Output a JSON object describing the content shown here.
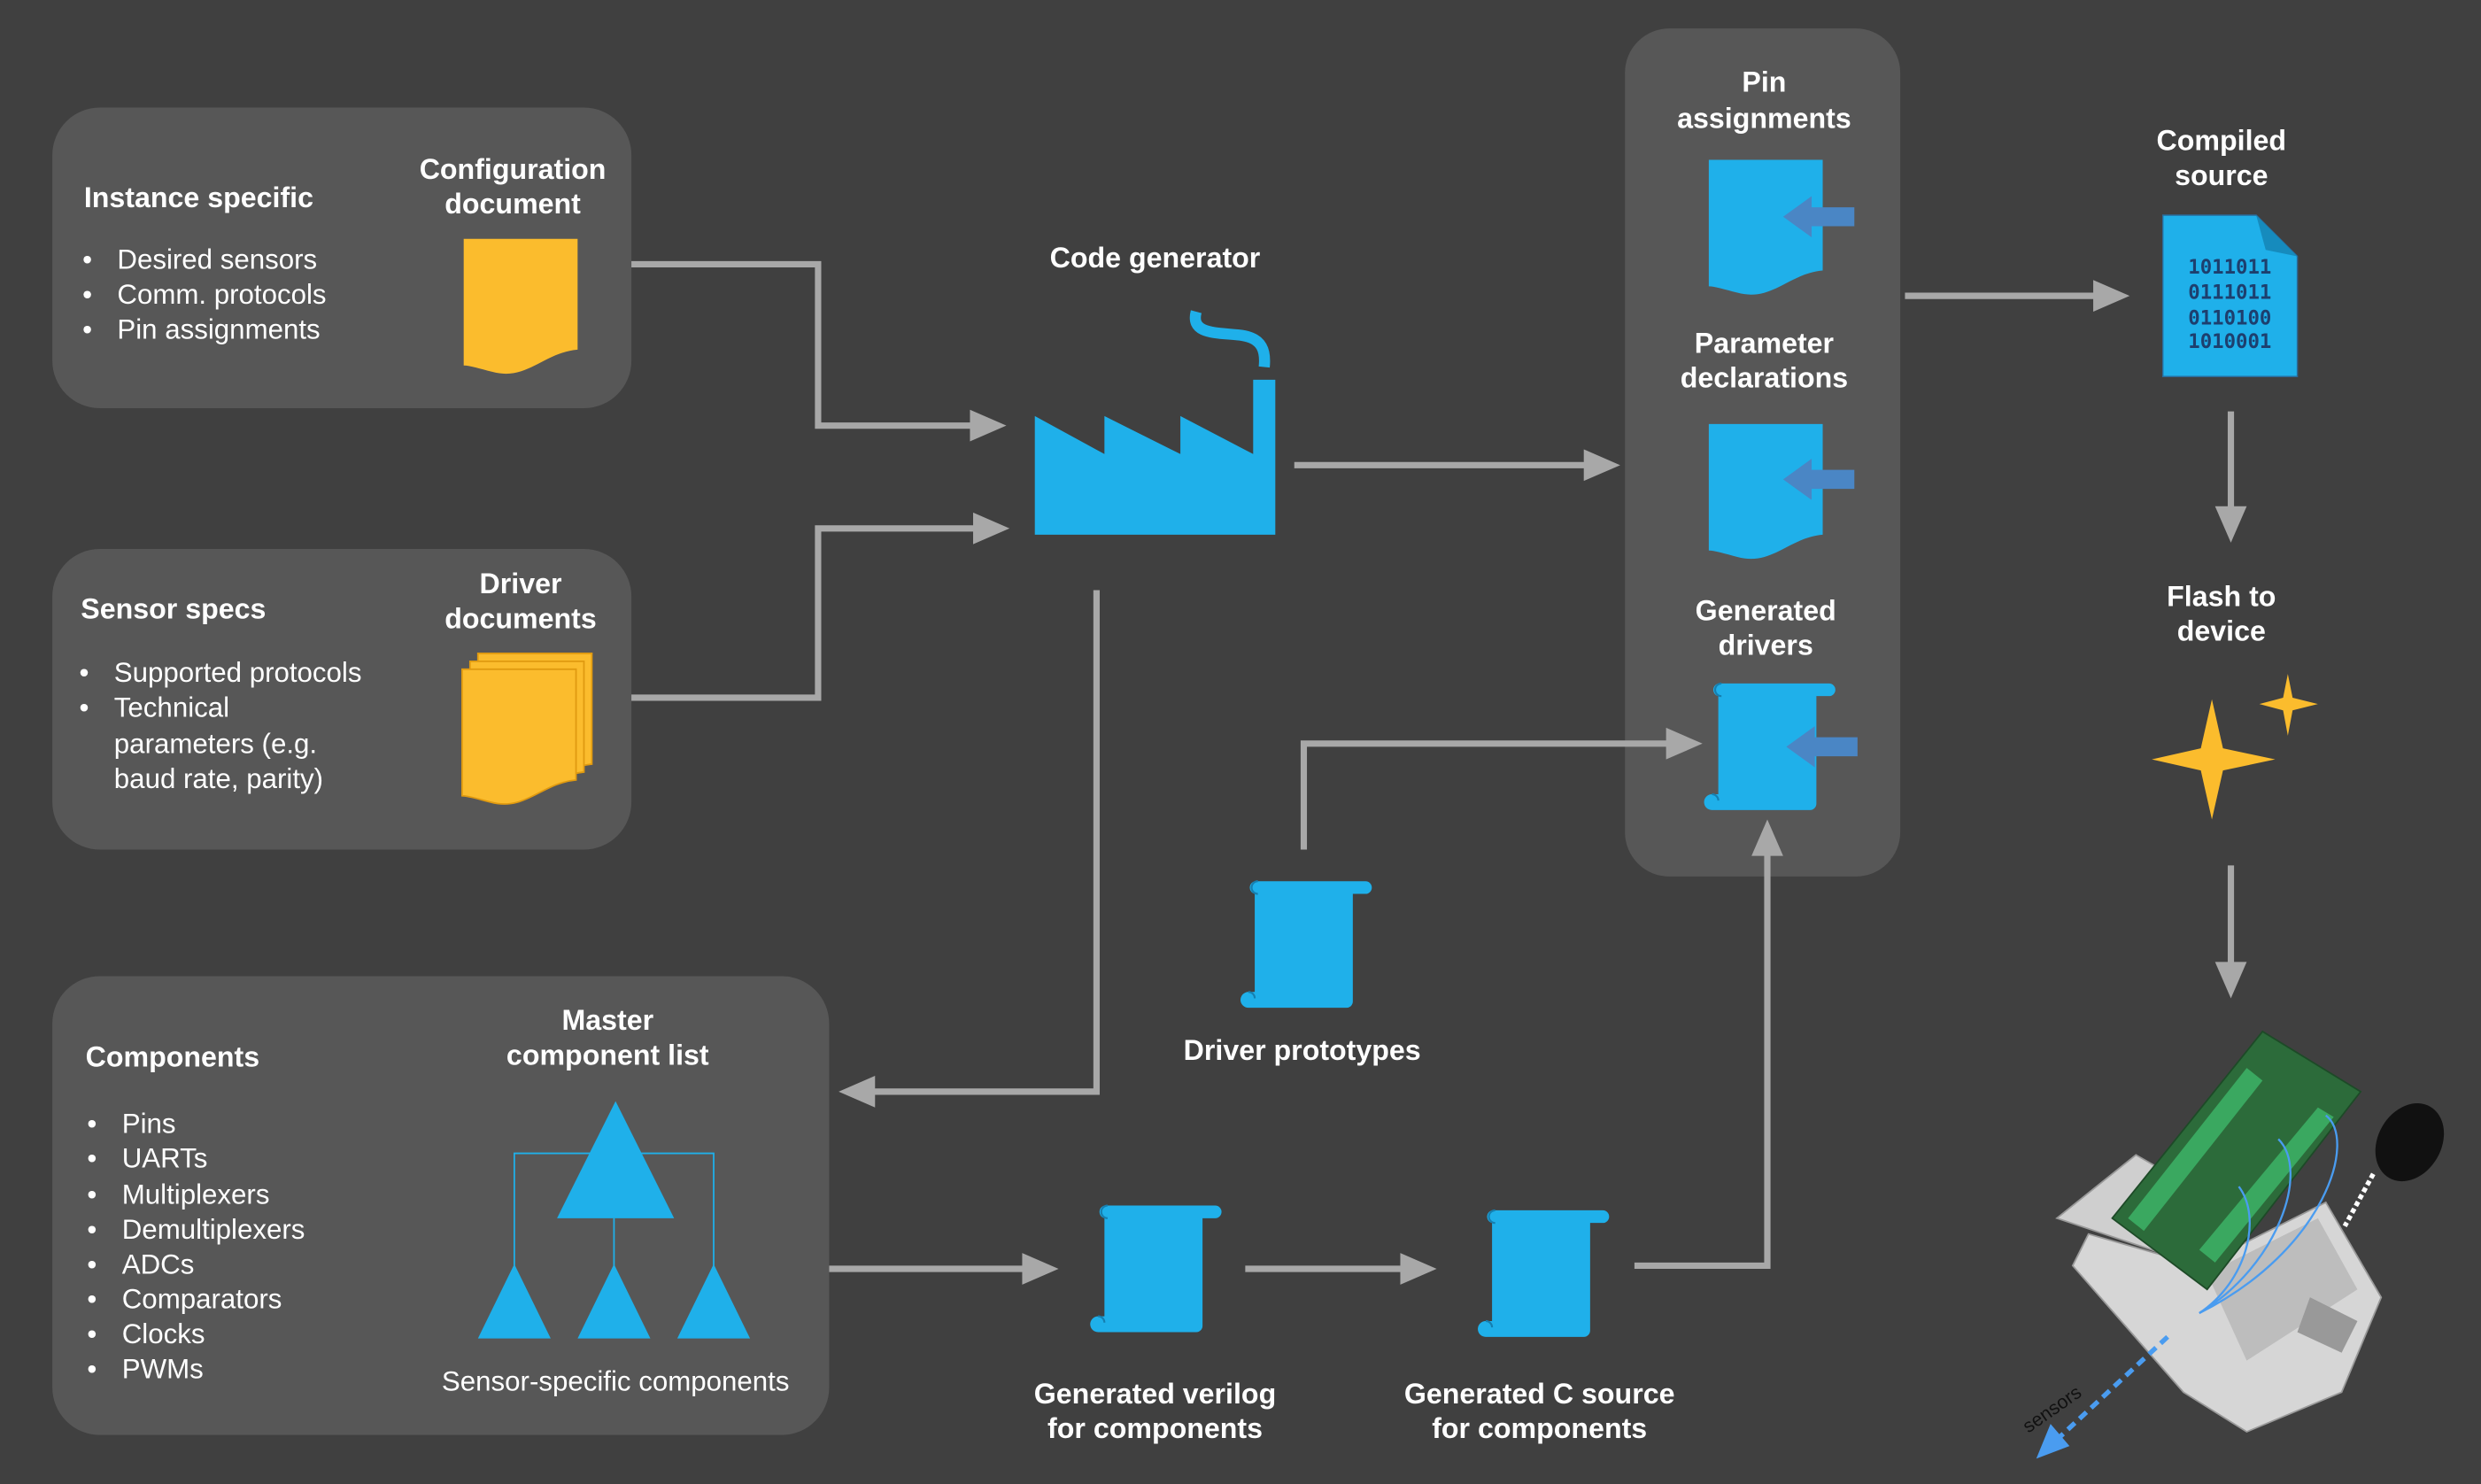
{
  "colors": {
    "background": "#404040",
    "panel": "#575757",
    "document_blue": "#1fb0ea",
    "document_yellow": "#fbbc2d",
    "arrow": "#a8a8a8",
    "star": "#fbbc2d"
  },
  "instance": {
    "title": "Instance specific",
    "bullets": [
      "Desired sensors",
      "Comm. protocols",
      "Pin assignments"
    ],
    "doc_label": [
      "Configuration",
      "document"
    ]
  },
  "sensor": {
    "title": "Sensor specs",
    "bullets": [
      "Supported protocols",
      "Technical",
      "parameters (e.g.",
      "baud rate, parity)"
    ],
    "doc_label": [
      "Driver",
      "documents"
    ]
  },
  "generator": {
    "label": "Code generator"
  },
  "outputs": {
    "pins": [
      "Pin",
      "assignments"
    ],
    "params": [
      "Parameter",
      "declarations"
    ],
    "drivers": [
      "Generated",
      "drivers"
    ]
  },
  "compiled": {
    "label": [
      "Compiled",
      "source"
    ],
    "binary": [
      "1011011",
      "0111011",
      "0110100",
      "1010001"
    ]
  },
  "flash": {
    "label": [
      "Flash to",
      "device"
    ]
  },
  "driver_prototypes": {
    "label": "Driver prototypes"
  },
  "components": {
    "title": "Components",
    "bullets": [
      "Pins",
      "UARTs",
      "Multiplexers",
      "Demultiplexers",
      "ADCs",
      "Comparators",
      "Clocks",
      "PWMs"
    ],
    "list_label": [
      "Master",
      "component list"
    ],
    "sub_label": "Sensor-specific components"
  },
  "verilog": {
    "label": [
      "Generated verilog",
      "for components"
    ]
  },
  "csource": {
    "label": [
      "Generated C source",
      "for components"
    ]
  },
  "device": {
    "sensors_label": "sensors"
  }
}
